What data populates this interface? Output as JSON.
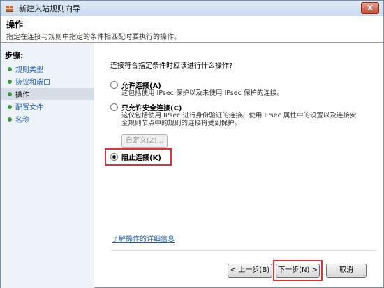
{
  "window": {
    "title": "新建入站规则向导",
    "close_label": "X"
  },
  "header": {
    "title": "操作",
    "description": "指定在连接与规则中指定的条件相匹配时要执行的操作。"
  },
  "sidebar": {
    "title": "步骤:",
    "items": [
      {
        "label": "规则类型"
      },
      {
        "label": "协议和端口"
      },
      {
        "label": "操作"
      },
      {
        "label": "配置文件"
      },
      {
        "label": "名称"
      }
    ],
    "current_index": 2
  },
  "main": {
    "question": "连接符合指定条件时应该进行什么操作?",
    "options": [
      {
        "label": "允许连接(A)",
        "description": "这包括使用 IPsec 保护以及未使用 IPsec 保护的连接。",
        "selected": false
      },
      {
        "label": "只允许安全连接(C)",
        "description_lines": [
          "这仅包括使用 IPsec 进行身份验证的连接。使用 IPsec 属性中的设置以及连接安",
          "全规则节点中的规则的连接将受到保护。"
        ],
        "selected": false,
        "customize_label": "自定义(Z)..."
      },
      {
        "label": "阻止连接(K)",
        "selected": true
      }
    ],
    "learn_more": "了解操作的详细信息"
  },
  "buttons": {
    "back": "< 上一步(B)",
    "next": "下一步(N) >",
    "cancel": "取消"
  },
  "colors": {
    "highlight": "#e0323a",
    "link": "#1f5fb0",
    "sidebar_bg": "#eef3fa"
  }
}
